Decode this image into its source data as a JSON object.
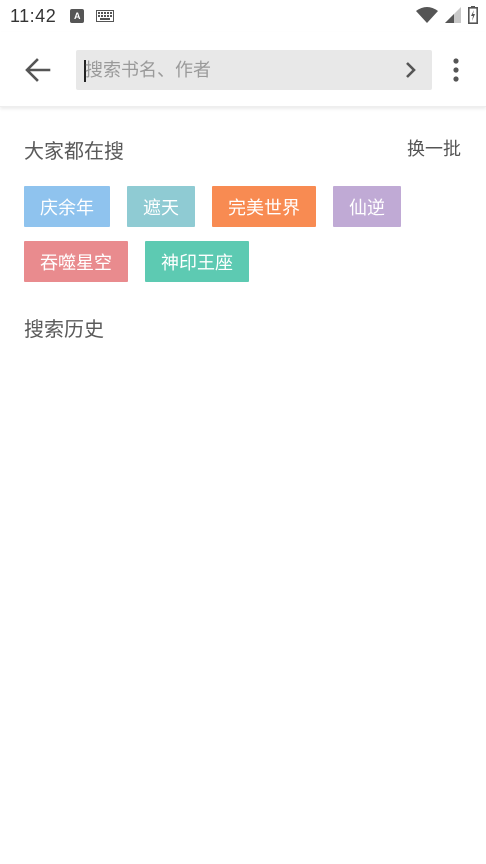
{
  "status_bar": {
    "time": "11:42",
    "a_icon_letter": "A"
  },
  "header": {
    "search_placeholder": "搜索书名、作者"
  },
  "hot_searches": {
    "title": "大家都在搜",
    "refresh_label": "换一批",
    "tags": [
      {
        "label": "庆余年",
        "color": "#8fc3ee"
      },
      {
        "label": "遮天",
        "color": "#8fcbd3"
      },
      {
        "label": "完美世界",
        "color": "#f88b52"
      },
      {
        "label": "仙逆",
        "color": "#c0aad5"
      },
      {
        "label": "吞噬星空",
        "color": "#e98b8e"
      },
      {
        "label": "神印王座",
        "color": "#5dcab2"
      }
    ]
  },
  "history": {
    "title": "搜索历史"
  },
  "icons": {
    "back": "arrow-left-icon",
    "search_go": "chevron-right-icon",
    "more": "more-vertical-icon",
    "wifi": "wifi-icon",
    "signal": "signal-icon",
    "battery": "battery-icon",
    "keyboard": "keyboard-icon"
  }
}
